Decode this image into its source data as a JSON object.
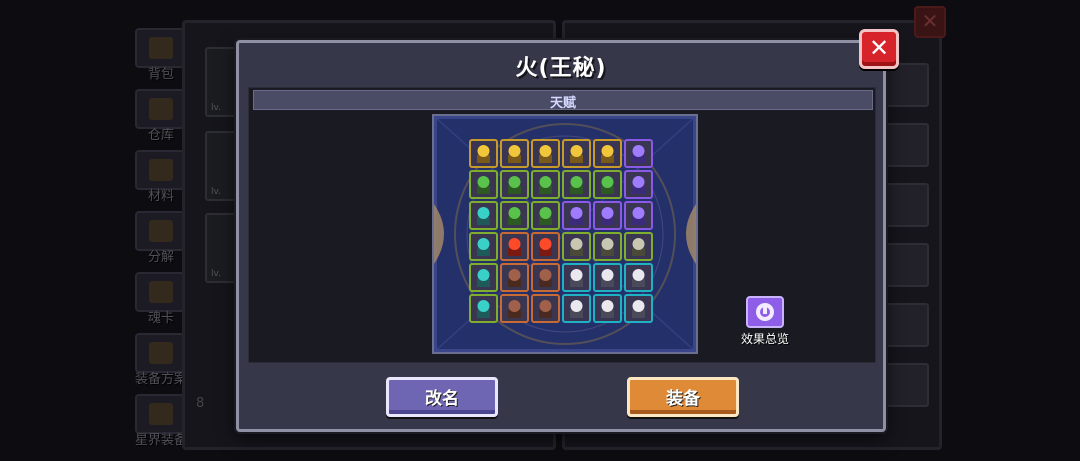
{
  "background": {
    "nav": [
      {
        "label": "背包",
        "icon": "backpack-icon"
      },
      {
        "label": "仓库",
        "icon": "warehouse-icon"
      },
      {
        "label": "材料",
        "icon": "materials-icon"
      },
      {
        "label": "分解",
        "icon": "disassemble-icon"
      },
      {
        "label": "魂卡",
        "icon": "soul-card-icon"
      },
      {
        "label": "装备方案",
        "icon": "equipment-plan-icon"
      },
      {
        "label": "星界装备",
        "icon": "astral-equipment-icon"
      }
    ],
    "cards": [
      {
        "label": "lv."
      },
      {
        "label": "lv."
      },
      {
        "label": "lv."
      }
    ],
    "stat_partial": "8",
    "close_glyph": "✕"
  },
  "modal": {
    "title": "火(王秘)",
    "close_glyph": "✕",
    "section_label": "天赋",
    "overview_label": "效果总览",
    "overview_icon": "talent-overview-icon",
    "rename_label": "改名",
    "equip_label": "装备"
  },
  "colors": {
    "gold": "#c79a2a",
    "green": "#7fae2e",
    "purple": "#8a5ae6",
    "orange": "#c86a34",
    "cyan": "#1fb2c4",
    "red": "#d94424"
  },
  "talent_grid": {
    "columns": 6,
    "rows": 6,
    "icons": [
      "gold-helmet",
      "gold-helmet",
      "gold-helmet",
      "gold-helmet",
      "gold-helmet",
      "purple-orb",
      "green-leaf",
      "green-leaf",
      "green-leaf",
      "green-leaf",
      "green-leaf",
      "purple-orb",
      "cyan-crystal",
      "green-leaf",
      "green-leaf",
      "purple-orb",
      "purple-orb",
      "purple-orb",
      "cyan-crystal",
      "red-flame",
      "red-flame",
      "bone-skull",
      "bone-skull",
      "bone-skull",
      "cyan-crystal",
      "brown-imp",
      "brown-imp",
      "white-fang",
      "white-fang",
      "white-fang",
      "cyan-crystal",
      "brown-imp",
      "brown-imp",
      "white-fang",
      "white-fang",
      "white-fang"
    ],
    "frames": [
      "gold",
      "gold",
      "gold",
      "gold",
      "gold",
      "purple",
      "green",
      "green",
      "green",
      "green",
      "green",
      "purple",
      "green",
      "green",
      "green",
      "purple",
      "purple",
      "purple",
      "green",
      "orange",
      "orange",
      "green",
      "green",
      "green",
      "green",
      "orange",
      "orange",
      "cyan",
      "cyan",
      "cyan",
      "green",
      "orange",
      "orange",
      "cyan",
      "cyan",
      "cyan"
    ]
  }
}
